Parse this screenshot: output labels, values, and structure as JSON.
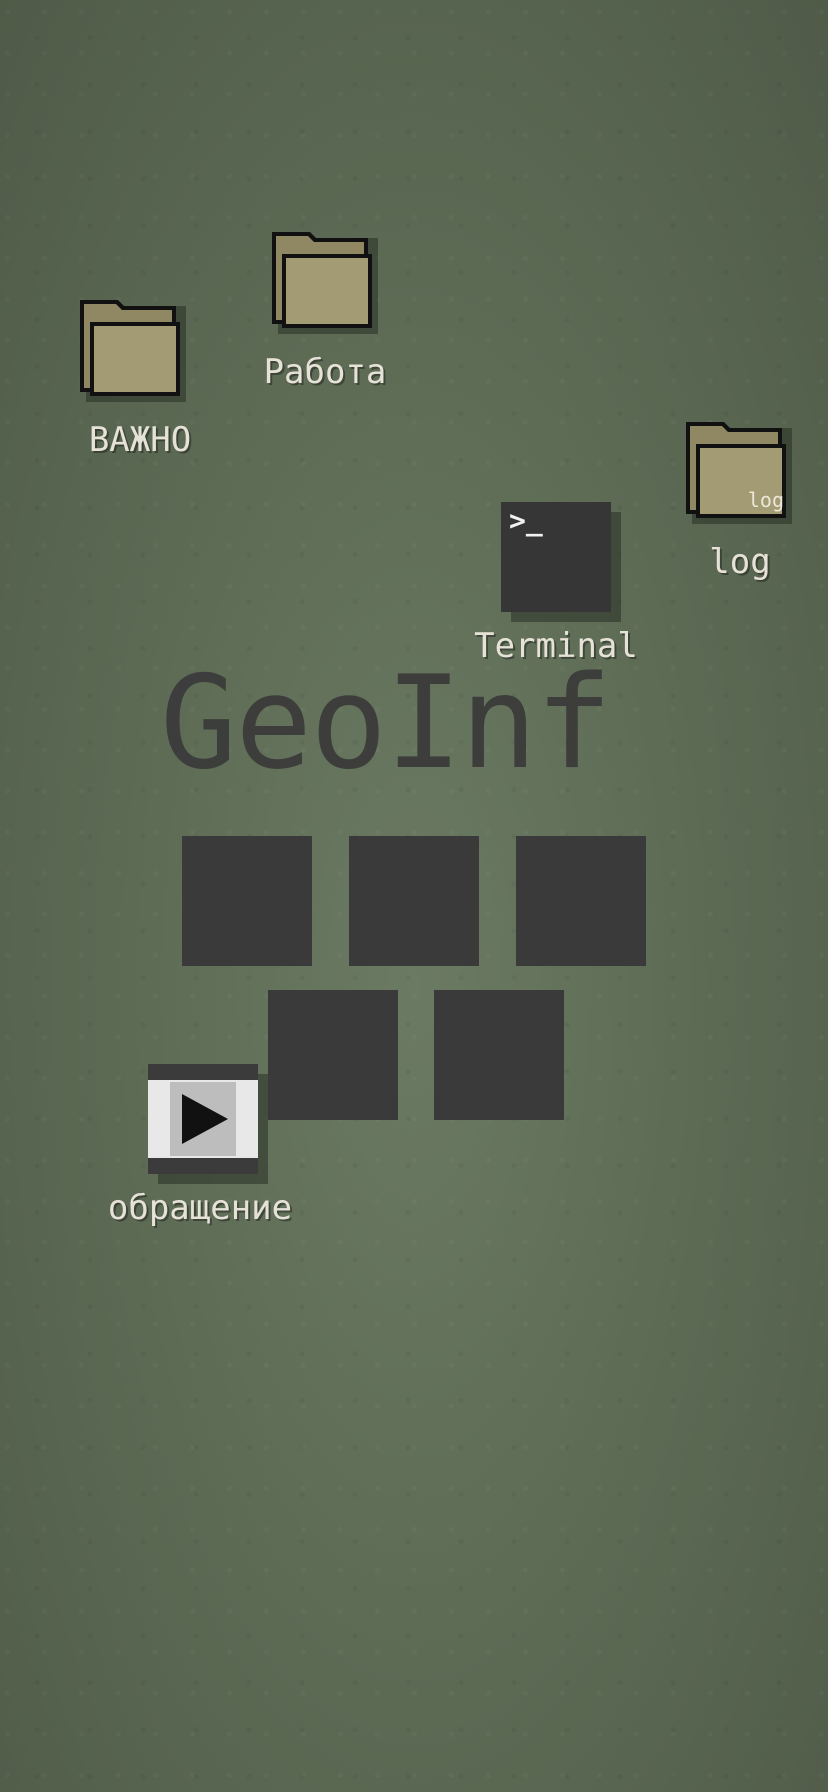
{
  "desktop": {
    "icons": {
      "vazhno": {
        "label": "ВАЖНО"
      },
      "rabota": {
        "label": "Работа"
      },
      "log": {
        "label": "log",
        "badge": "log"
      },
      "terminal": {
        "label": "Terminal",
        "prompt": ">_"
      },
      "obrashchenie": {
        "label": "обращение"
      }
    },
    "title": "GeoInf",
    "tiles_count": 5
  },
  "colors": {
    "background": "#5e6c56",
    "folder": "#a29b74",
    "tile": "#3a3a3a",
    "label": "#e6e2d8"
  }
}
